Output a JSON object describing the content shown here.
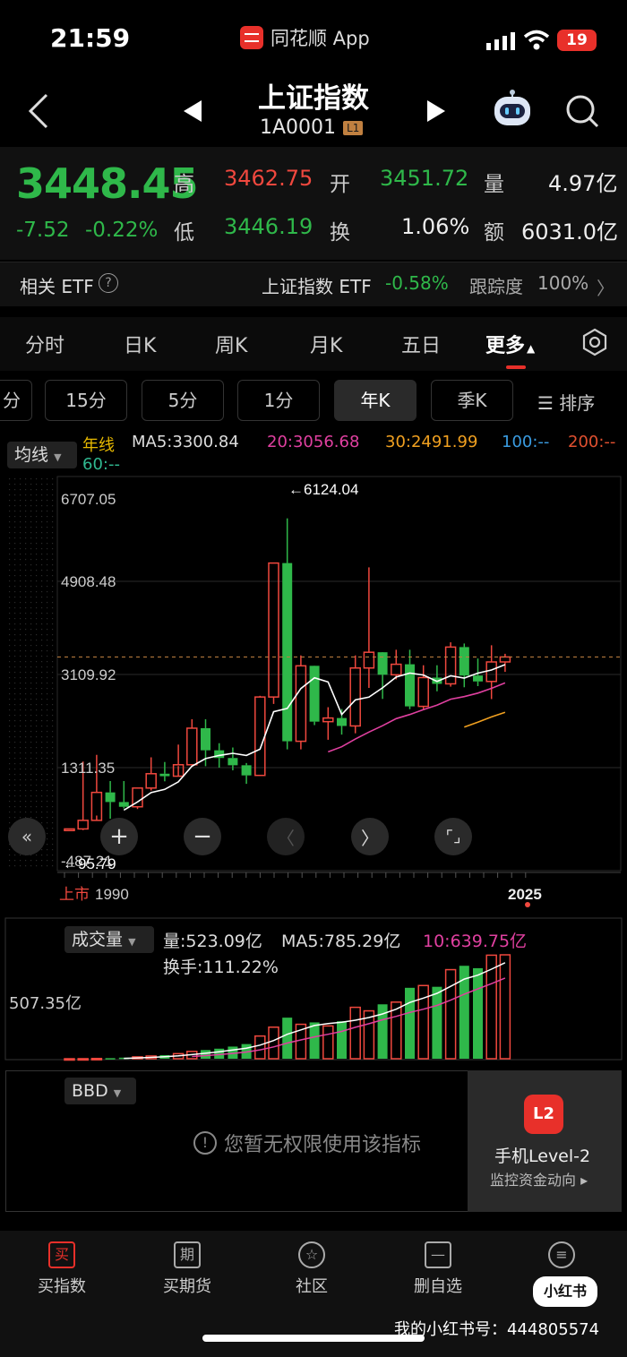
{
  "status": {
    "time": "21:59",
    "app": "同花顺 App",
    "battery": "19"
  },
  "header": {
    "title": "上证指数",
    "code": "1A0001",
    "level": "L1"
  },
  "quote": {
    "price": "3448.45",
    "change": "-7.52",
    "change_pct": "-0.22%",
    "high_label": "高",
    "high": "3462.75",
    "open_label": "开",
    "open": "3451.72",
    "volume_label": "量",
    "volume": "4.97亿",
    "low_label": "低",
    "low": "3446.19",
    "turnover_label": "换",
    "turnover": "1.06%",
    "amount_label": "额",
    "amount": "6031.0亿"
  },
  "etf": {
    "label": "相关 ETF",
    "name": "上证指数 ETF",
    "change": "-0.58%",
    "track_label": "跟踪度",
    "track": "100%"
  },
  "tabs": [
    "分时",
    "日K",
    "周K",
    "月K",
    "五日",
    "更多"
  ],
  "intervals": [
    "分",
    "15分",
    "5分",
    "1分",
    "年K",
    "季K"
  ],
  "sort_label": "排序",
  "ma_legend": {
    "select": "均线",
    "period": "年线",
    "ma5": "MA5:3300.84",
    "ma20": "20:3056.68",
    "ma30": "30:2491.99",
    "ma100": "100:--",
    "ma200": "200:--",
    "ma60": "60:--"
  },
  "chart_data": {
    "type": "candlestick",
    "y_ticks": [
      "6707.05",
      "4908.48",
      "3109.92",
      "1311.35",
      "-487.21"
    ],
    "ylim": [
      -487.21,
      6707.05
    ],
    "max_annotation": "←6124.04",
    "min_annotation": "←95.79",
    "x_start_label": "上市",
    "x_labels": [
      "1990",
      "2025"
    ],
    "candles": [
      {
        "o": 96,
        "h": 128,
        "l": 96,
        "c": 128
      },
      {
        "o": 128,
        "h": 1429,
        "l": 105,
        "c": 293
      },
      {
        "o": 293,
        "h": 1558,
        "l": 386,
        "c": 833
      },
      {
        "o": 833,
        "h": 1052,
        "l": 325,
        "c": 647
      },
      {
        "o": 647,
        "h": 1052,
        "l": 524,
        "c": 555
      },
      {
        "o": 555,
        "h": 917,
        "l": 512,
        "c": 917
      },
      {
        "o": 917,
        "h": 1510,
        "l": 870,
        "c": 1194
      },
      {
        "o": 1194,
        "h": 1420,
        "l": 1047,
        "c": 1146
      },
      {
        "o": 1146,
        "h": 1756,
        "l": 1341,
        "c": 1367
      },
      {
        "o": 1367,
        "h": 2245,
        "l": 1361,
        "c": 2073
      },
      {
        "o": 2073,
        "h": 2245,
        "l": 1339,
        "c": 1646
      },
      {
        "o": 1646,
        "h": 1783,
        "l": 1311,
        "c": 1497
      },
      {
        "o": 1497,
        "h": 1700,
        "l": 1259,
        "c": 1357
      },
      {
        "o": 1357,
        "h": 1400,
        "l": 998,
        "c": 1161
      },
      {
        "o": 1161,
        "h": 2698,
        "l": 1163,
        "c": 2675
      },
      {
        "o": 2675,
        "h": 5261,
        "l": 2541,
        "c": 5261
      },
      {
        "o": 5261,
        "h": 6124,
        "l": 1664,
        "c": 1820
      },
      {
        "o": 1820,
        "h": 3478,
        "l": 1664,
        "c": 3277
      },
      {
        "o": 3277,
        "h": 3067,
        "l": 2132,
        "c": 2199
      },
      {
        "o": 2199,
        "h": 2478,
        "l": 1849,
        "c": 2269
      },
      {
        "o": 2269,
        "h": 2444,
        "l": 1949,
        "c": 2116
      },
      {
        "o": 2116,
        "h": 3478,
        "l": 1974,
        "c": 3235
      },
      {
        "o": 3235,
        "h": 5178,
        "l": 2850,
        "c": 3539
      },
      {
        "o": 3539,
        "h": 3301,
        "l": 2638,
        "c": 3104
      },
      {
        "o": 3104,
        "h": 3587,
        "l": 3016,
        "c": 3307
      },
      {
        "o": 3307,
        "h": 3587,
        "l": 2440,
        "c": 2494
      },
      {
        "o": 2494,
        "h": 3288,
        "l": 2440,
        "c": 3050
      },
      {
        "o": 3050,
        "h": 3288,
        "l": 2785,
        "c": 2929
      },
      {
        "o": 2929,
        "h": 3731,
        "l": 2875,
        "c": 3639
      },
      {
        "o": 3639,
        "h": 3708,
        "l": 2863,
        "c": 3089
      },
      {
        "o": 3089,
        "h": 3418,
        "l": 2885,
        "c": 2975
      },
      {
        "o": 2975,
        "h": 3674,
        "l": 2635,
        "c": 3352
      },
      {
        "o": 3352,
        "h": 3509,
        "l": 3160,
        "c": 3448
      }
    ],
    "ma_lines_description": "moving averages drawn in white, magenta and orange"
  },
  "volume": {
    "select": "成交量",
    "vol": "量:523.09亿",
    "ma5": "MA5:785.29亿",
    "ma10": "10:639.75亿",
    "turnover": "换手:111.22%",
    "y_tick": "507.35亿"
  },
  "bbd": {
    "select": "BBD",
    "message": "您暂无权限使用该指标",
    "card_title": "手机Level-2",
    "card_sub": "监控资金动向 ▸",
    "icon_text": "L2"
  },
  "nav": [
    "买指数",
    "买期货",
    "社区",
    "删自选",
    ""
  ],
  "nav_icons": [
    "买",
    "期",
    "☆",
    "—",
    "≡"
  ],
  "watermark": "我的小红书号：444805574",
  "xhs": "小红书"
}
